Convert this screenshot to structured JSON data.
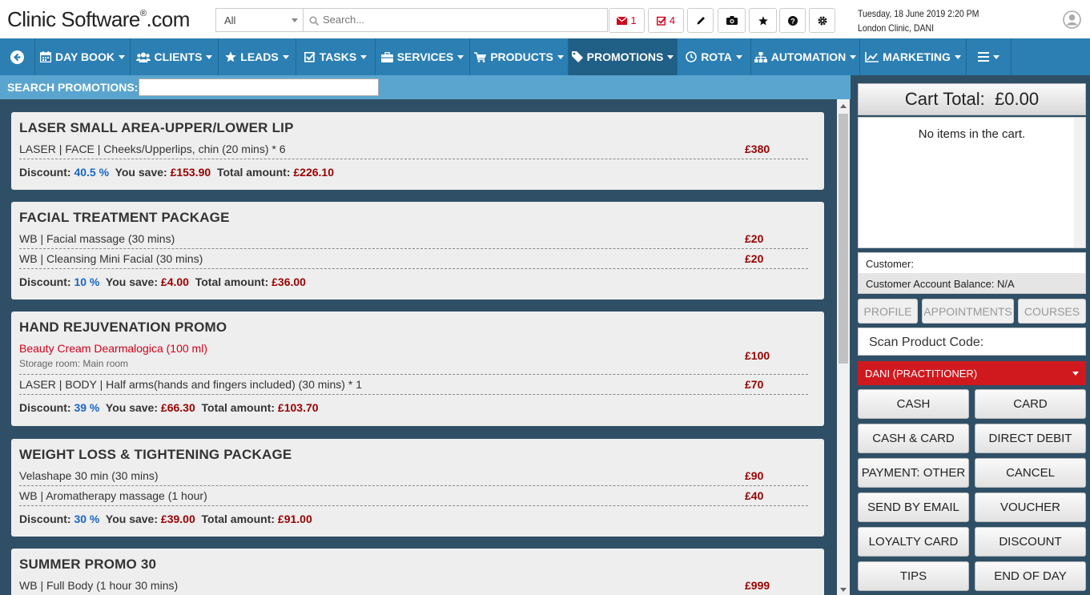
{
  "header": {
    "logo_main": "Clinic Software",
    "logo_reg": "®",
    "logo_tld": ".com",
    "category_selected": "All",
    "search_placeholder": "Search...",
    "mail_count": "1",
    "tasks_count": "4",
    "date": "Tuesday, 18 June 2019  2:20 PM",
    "location": "London Clinic, DANI",
    "icons": [
      "envelope-icon",
      "check-square-icon",
      "pencil-icon",
      "camera-icon",
      "star-icon",
      "question-icon",
      "gear-icon",
      "user-avatar-icon"
    ]
  },
  "nav": [
    {
      "label": "DAY BOOK",
      "icon": "calendar-icon"
    },
    {
      "label": "CLIENTS",
      "icon": "users-icon"
    },
    {
      "label": "LEADS",
      "icon": "star-icon"
    },
    {
      "label": "TASKS",
      "icon": "check-square-icon"
    },
    {
      "label": "SERVICES",
      "icon": "briefcase-icon"
    },
    {
      "label": "PRODUCTS",
      "icon": "cart-icon"
    },
    {
      "label": "PROMOTIONS",
      "icon": "tag-icon"
    },
    {
      "label": "ROTA",
      "icon": "clock-icon"
    },
    {
      "label": "AUTOMATION",
      "icon": "sitemap-icon"
    },
    {
      "label": "MARKETING",
      "icon": "chart-line-icon"
    }
  ],
  "search_promotions_label": "SEARCH PROMOTIONS:",
  "promotions": [
    {
      "title": "LASER SMALL AREA-UPPER/LOWER LIP",
      "items": [
        {
          "text": "LASER | FACE | Cheeks/Upperlips, chin (20 mins) * 6",
          "price": "£380"
        }
      ],
      "discount": "40.5 %",
      "save": "£153.90",
      "total": "£226.10"
    },
    {
      "title": "FACIAL TREATMENT PACKAGE",
      "items": [
        {
          "text": "WB | Facial massage (30 mins)",
          "price": "£20"
        },
        {
          "text": "WB | Cleansing Mini Facial (30 mins)",
          "price": "£20"
        }
      ],
      "discount": "10 %",
      "save": "£4.00",
      "total": "£36.00"
    },
    {
      "title": "HAND REJUVENATION PROMO",
      "product": {
        "name": "Beauty Cream Dearmalogica (100 ml)",
        "storage": "Storage room: Main room",
        "price": "£100"
      },
      "items": [
        {
          "text": "LASER | BODY | Half arms(hands and fingers included) (30 mins) * 1",
          "price": "£70"
        }
      ],
      "discount": "39 %",
      "save": "£66.30",
      "total": "£103.70"
    },
    {
      "title": "WEIGHT LOSS & TIGHTENING PACKAGE",
      "items": [
        {
          "text": "Velashape 30 min (30 mins)",
          "price": "£90"
        },
        {
          "text": "WB | Aromatherapy massage (1 hour)",
          "price": "£40"
        }
      ],
      "discount": "30 %",
      "save": "£39.00",
      "total": "£91.00"
    },
    {
      "title": "SUMMER PROMO 30",
      "items": [
        {
          "text": "WB | Full Body (1 hour 30 mins)",
          "price": "£999"
        }
      ]
    }
  ],
  "labels": {
    "discount": "Discount:",
    "save": "You save:",
    "total": "Total amount:"
  },
  "cart": {
    "title": "Cart Total:",
    "total": "£0.00",
    "empty": "No items in the cart.",
    "customer": "Customer:",
    "balance": "Customer Account Balance: N/A",
    "tabs": [
      "PROFILE",
      "APPOINTMENTS",
      "COURSES"
    ],
    "scan_label": "Scan Product Code:",
    "staff": "DANI (PRACTITIONER)",
    "buttons": [
      "CASH",
      "CARD",
      "CASH & CARD",
      "DIRECT DEBIT",
      "PAYMENT: OTHER",
      "CANCEL",
      "SEND BY EMAIL",
      "VOUCHER",
      "LOYALTY CARD",
      "DISCOUNT",
      "TIPS",
      "END OF DAY"
    ]
  }
}
